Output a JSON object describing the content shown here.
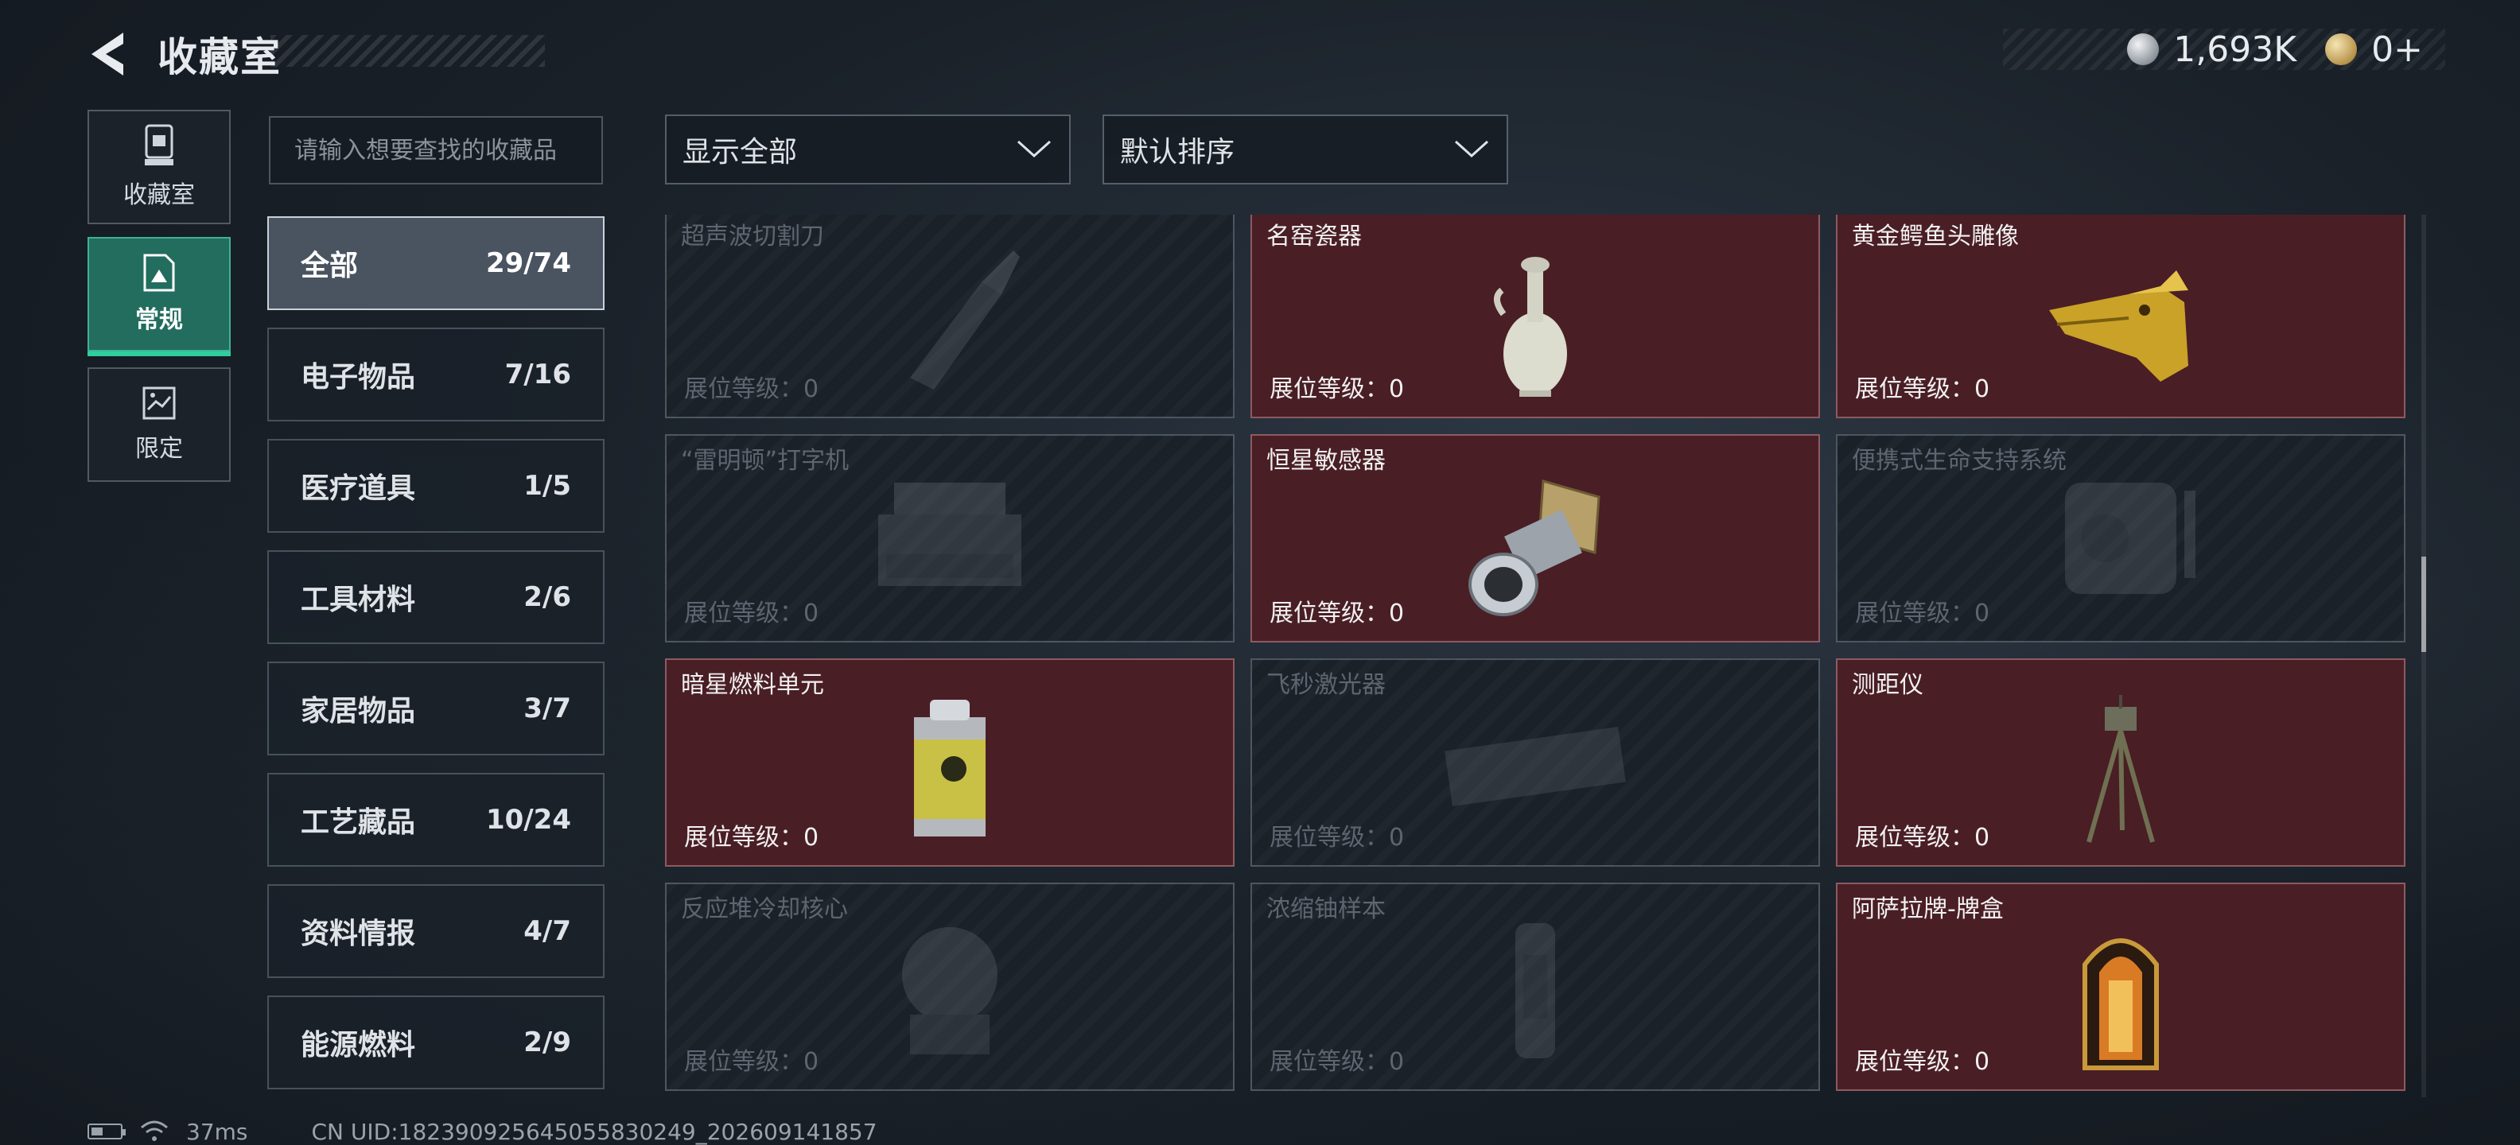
{
  "header": {
    "title": "收藏室"
  },
  "currency": [
    {
      "icon": "silver-coin-icon",
      "value": "1,693K"
    },
    {
      "icon": "gold-coin-icon",
      "value": "0+"
    }
  ],
  "rail": [
    {
      "label": "收藏室",
      "icon": "display-case-icon",
      "active": false
    },
    {
      "label": "常规",
      "icon": "picture-frame-icon",
      "active": true
    },
    {
      "label": "限定",
      "icon": "limited-frame-icon",
      "active": false
    }
  ],
  "search": {
    "placeholder": "请输入想要查找的收藏品"
  },
  "categories": [
    {
      "name": "全部",
      "count": "29/74",
      "active": true
    },
    {
      "name": "电子物品",
      "count": "7/16"
    },
    {
      "name": "医疗道具",
      "count": "1/5"
    },
    {
      "name": "工具材料",
      "count": "2/6"
    },
    {
      "name": "家居物品",
      "count": "3/7"
    },
    {
      "name": "工艺藏品",
      "count": "10/24"
    },
    {
      "name": "资料情报",
      "count": "4/7"
    },
    {
      "name": "能源燃料",
      "count": "2/9"
    }
  ],
  "filters": {
    "display": "显示全部",
    "sort": "默认排序"
  },
  "items": [
    {
      "name": "超声波切割刀",
      "level": "展位等级：0",
      "owned": false,
      "icon": "ultrasonic-cutter-icon"
    },
    {
      "name": "名窑瓷器",
      "level": "展位等级：0",
      "owned": true,
      "icon": "porcelain-vase-icon"
    },
    {
      "name": "黄金鳄鱼头雕像",
      "level": "展位等级：0",
      "owned": true,
      "icon": "gold-crocodile-head-icon"
    },
    {
      "name": "“雷明顿”打字机",
      "level": "展位等级：0",
      "owned": false,
      "icon": "typewriter-icon"
    },
    {
      "name": "恒星敏感器",
      "level": "展位等级：0",
      "owned": true,
      "icon": "star-sensor-icon"
    },
    {
      "name": "便携式生命支持系统",
      "level": "展位等级：0",
      "owned": false,
      "icon": "life-support-icon"
    },
    {
      "name": "暗星燃料单元",
      "level": "展位等级：0",
      "owned": true,
      "icon": "fuel-canister-icon"
    },
    {
      "name": "飞秒激光器",
      "level": "展位等级：0",
      "owned": false,
      "icon": "laser-icon"
    },
    {
      "name": "测距仪",
      "level": "展位等级：0",
      "owned": true,
      "icon": "rangefinder-tripod-icon"
    },
    {
      "name": "反应堆冷却核心",
      "level": "展位等级：0",
      "owned": false,
      "icon": "reactor-core-icon"
    },
    {
      "name": "浓缩铀样本",
      "level": "展位等级：0",
      "owned": false,
      "icon": "uranium-sample-icon"
    },
    {
      "name": "阿萨拉牌-牌盒",
      "level": "展位等级：0",
      "owned": true,
      "icon": "card-box-icon"
    }
  ],
  "footer": {
    "ping": "37ms",
    "uid": "CN UID:18239092564505583​0249_202609141857"
  }
}
